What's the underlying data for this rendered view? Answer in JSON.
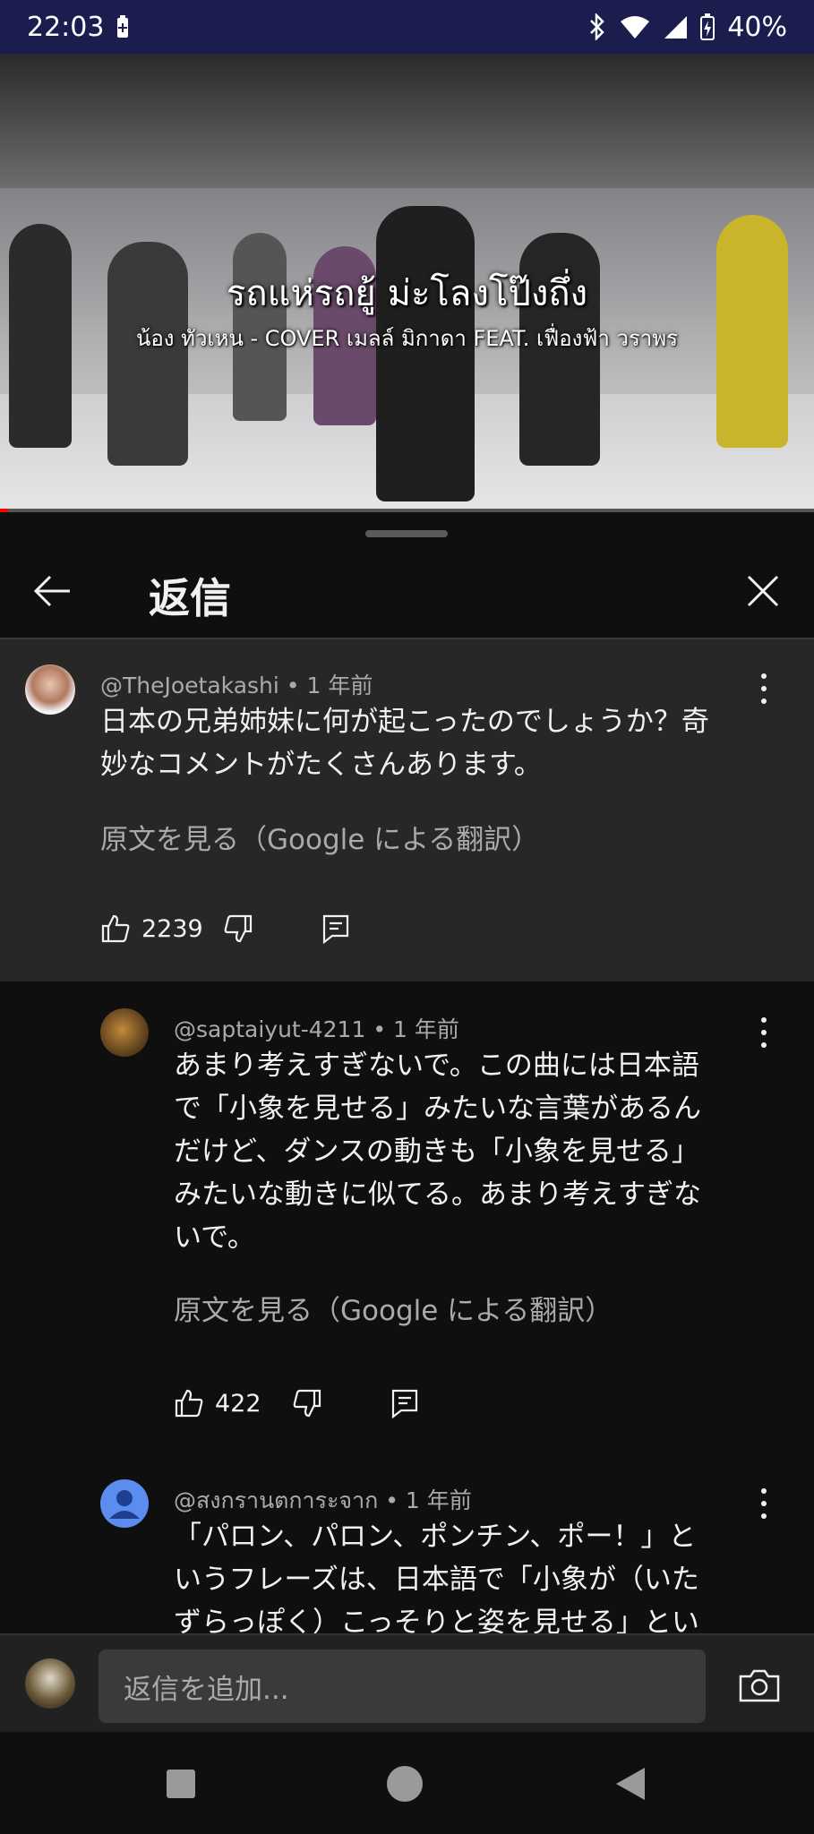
{
  "status": {
    "time": "22:03",
    "battery": "40%"
  },
  "video": {
    "title": "รถแห่รถยู้ ม่ะโลงโป๊งถึ่ง",
    "subtitle": "น้อง ทัวเหน - COVER เมลล์ มิกาดา FEAT. เฟื่องฟ้า วราพร",
    "progress": 0.01
  },
  "header": {
    "title": "返信"
  },
  "parent_comment": {
    "author": "@TheJoetakashi",
    "age": "1 年前",
    "text_line1": "日本の兄弟姉妹に何が起こったのでしょうか？奇",
    "text_line2": "妙なコメントがたくさんあります。",
    "translate": "原文を見る（Google による翻訳）",
    "likes": "2239"
  },
  "replies": [
    {
      "author": "@saptaiyut-4211",
      "age": "1 年前",
      "lines": [
        "あまり考えすぎないで。この曲には日本語",
        "で「小象を見せる」みたいな言葉があるん",
        "だけど、ダンスの動きも「小象を見せる」",
        "みたいな動きに似てる。あまり考えすぎな",
        "いで。"
      ],
      "translate": "原文を見る（Google による翻訳）",
      "likes": "422"
    },
    {
      "author": "@สงกรานตการะจาก",
      "age": "1 年前",
      "lines": [
        "「パロン、パロン、ポンチン、ポー！」と",
        "いうフレーズは、日本語で「小象が（いた",
        "ずらっぽく）こっそりと姿を見せる」とい"
      ]
    }
  ],
  "reply_bar": {
    "placeholder": "返信を追加..."
  },
  "colors": {
    "accent": "#ff0000",
    "status_bar": "#1b1d4f",
    "surface": "#272727",
    "background": "#0f0f0f"
  }
}
